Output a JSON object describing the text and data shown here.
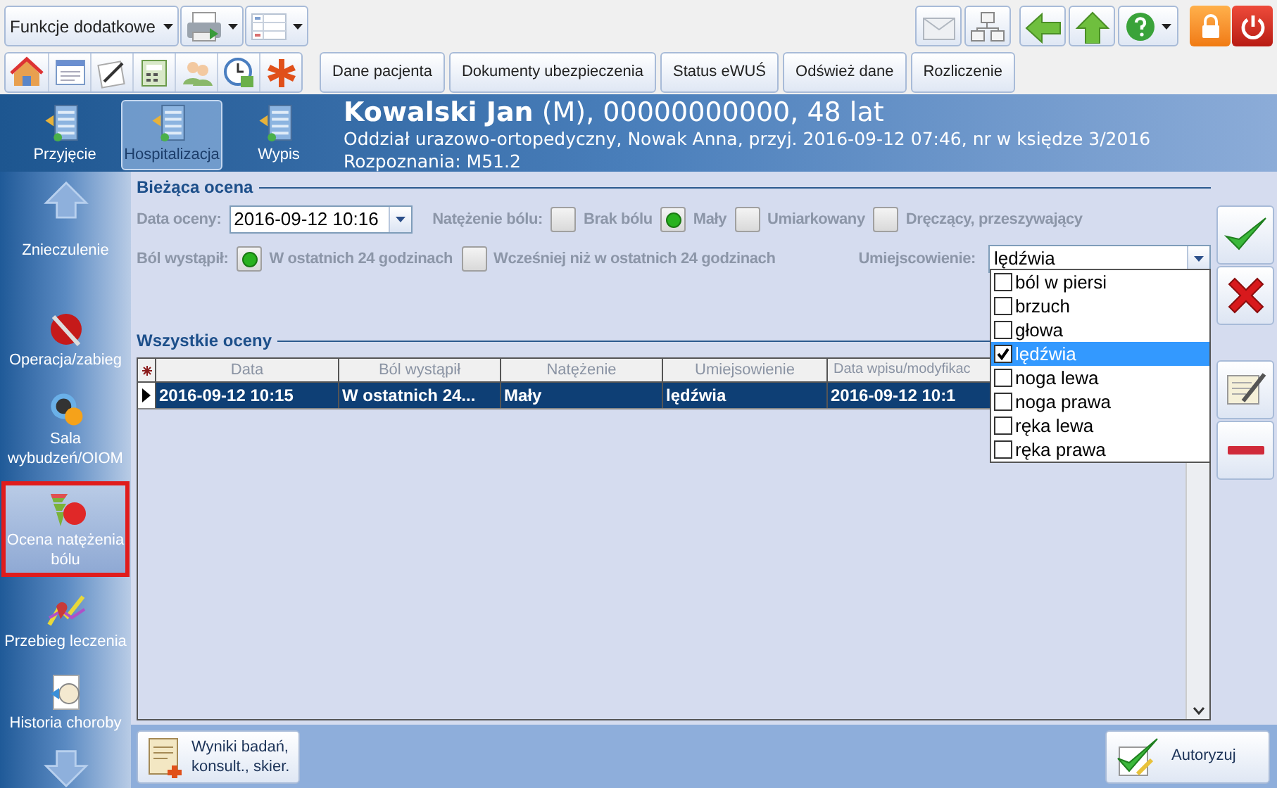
{
  "toolbar": {
    "menu_button": "Funkcje dodatkowe",
    "buttons": [
      "Dane pacjenta",
      "Dokumenty ubezpieczenia",
      "Status eWUŚ",
      "Odśwież dane",
      "Rozliczenie"
    ]
  },
  "stage_nav": [
    {
      "label": "Przyjęcie",
      "selected": false
    },
    {
      "label": "Hospitalizacja",
      "selected": true
    },
    {
      "label": "Wypis",
      "selected": false
    }
  ],
  "patient": {
    "title": "**Kowalski Jan** (M), 00000000000, 48 lat",
    "ward": "Oddział urazowo-ortopedyczny, Nowak Anna, przyj. 2016-09-12 07:46, nr w księdze 3/2016",
    "diagnosis": "Rozpoznania: M51.2"
  },
  "sidebar": {
    "items": [
      {
        "label": "Znieczulenie",
        "selected": false
      },
      {
        "label": "Operacja/zabieg",
        "selected": false
      },
      {
        "label": "Sala wybudzeń/OIOM",
        "selected": false
      },
      {
        "label": "Ocena natężenia bólu",
        "selected": true
      },
      {
        "label": "Przebieg leczenia",
        "selected": false
      },
      {
        "label": "Historia choroby",
        "selected": false
      }
    ]
  },
  "current": {
    "title": "Bieżąca ocena",
    "date_label": "Data oceny:",
    "date_value": "2016-09-12 10:16",
    "intensity_label": "Natężenie bólu:",
    "intensity_options": [
      {
        "label": "Brak bólu",
        "selected": false
      },
      {
        "label": "Mały",
        "selected": true
      },
      {
        "label": "Umiarkowany",
        "selected": false
      },
      {
        "label": "Dręczący, przeszywający",
        "selected": false
      }
    ],
    "onset_label": "Ból wystąpił:",
    "onset_options": [
      {
        "label": "W ostatnich 24 godzinach",
        "selected": true
      },
      {
        "label": "Wcześniej niż w ostatnich 24 godzinach",
        "selected": false
      }
    ],
    "location_label": "Umiejscowienie:",
    "location_value": "lędźwia",
    "location_options": [
      {
        "label": "ból w piersi",
        "checked": false,
        "selected": false
      },
      {
        "label": "brzuch",
        "checked": false,
        "selected": false
      },
      {
        "label": "głowa",
        "checked": false,
        "selected": false
      },
      {
        "label": "lędźwia",
        "checked": true,
        "selected": true
      },
      {
        "label": "noga lewa",
        "checked": false,
        "selected": false
      },
      {
        "label": "noga prawa",
        "checked": false,
        "selected": false
      },
      {
        "label": "ręka lewa",
        "checked": false,
        "selected": false
      },
      {
        "label": "ręka prawa",
        "checked": false,
        "selected": false
      }
    ]
  },
  "table": {
    "title": "Wszystkie oceny",
    "columns": [
      "Data",
      "Ból wystąpił",
      "Natężenie",
      "Umiejsowienie",
      "Data wpisu/modyfikac"
    ],
    "rows": [
      {
        "cells": [
          "2016-09-12 10:15",
          "W ostatnich 24...",
          "Mały",
          "lędźwia",
          "2016-09-12 10:1"
        ],
        "selected": true
      }
    ]
  },
  "bottom": {
    "results_button": [
      "Wyniki badań,",
      "konsult., skier."
    ],
    "authorize_button": "Autoryzuj"
  }
}
